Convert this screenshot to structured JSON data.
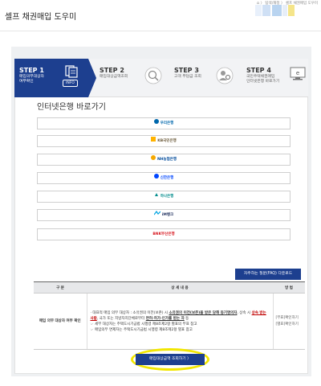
{
  "header": {
    "title": "셀프 채권매입 도우미",
    "breadcrumb": [
      "⌂",
      "탐색/재정",
      "셀프 채권매입 도우미"
    ],
    "breadcrumb_sep": "〉"
  },
  "steps": [
    {
      "num": "STEP 1",
      "desc": "매입의무대상자\n여부확인",
      "badge": "INFO",
      "active": true
    },
    {
      "num": "STEP 2",
      "desc": "매입대상금액조회",
      "icon": "magnifier-icon"
    },
    {
      "num": "STEP 3",
      "desc": "고객 부담금 조회",
      "icon": "person-search-icon"
    },
    {
      "num": "STEP 4",
      "desc": "국민주택채권매입\n인터넷은행 바로가기",
      "icon": "computer-icon"
    }
  ],
  "section_title": "인터넷은행 바로가기",
  "banks": [
    {
      "name": "우리은행",
      "color": "#0067ac"
    },
    {
      "name": "KB국민은행",
      "color": "#ffb300"
    },
    {
      "name": "NH농협은행",
      "color": "#00a651"
    },
    {
      "name": "신한은행",
      "color": "#0046ff"
    },
    {
      "name": "하나은행",
      "color": "#008c8c"
    },
    {
      "name": "iM뱅크",
      "color": "#00a3e0"
    },
    {
      "name": "BNK부산은행",
      "color": "#d71920"
    }
  ],
  "faq_button": "자주하는 질문(FAQ) 다운로드",
  "table": {
    "headers": [
      "구 분",
      "상 세 내 용",
      "방 법"
    ],
    "type_label": "매입 의무 대상자 여부 확인",
    "detail_prefix": "· 대표적 매입 의무 대상자 : 소유권의 이전(보존) 시 ",
    "detail_highlight1": "소유권의 이전(보존)을 받은 당해 등기명의자",
    "detail_mid": ", 상속 시 ",
    "detail_highlight2": "상속 받는 사람",
    "detail_mid2": ", 국가 또는 지방자치단체로부터 ",
    "detail_highlight3": "면허·허가·인가를 받는 자",
    "detail_suffix": " 등",
    "note1": "☞ 세부 대상자는 주택도시기금법 시행령 제8조제2항 별표의 부표 참고",
    "note2": "☞ 매입의무 면제자는 주택도시기금법 시행령 제8조제2항 별표 참고",
    "method_line1": "[부표]확인하기",
    "method_line2": "[별표]확인하기"
  },
  "primary_button": "매입대상금액 조회하기 〉"
}
